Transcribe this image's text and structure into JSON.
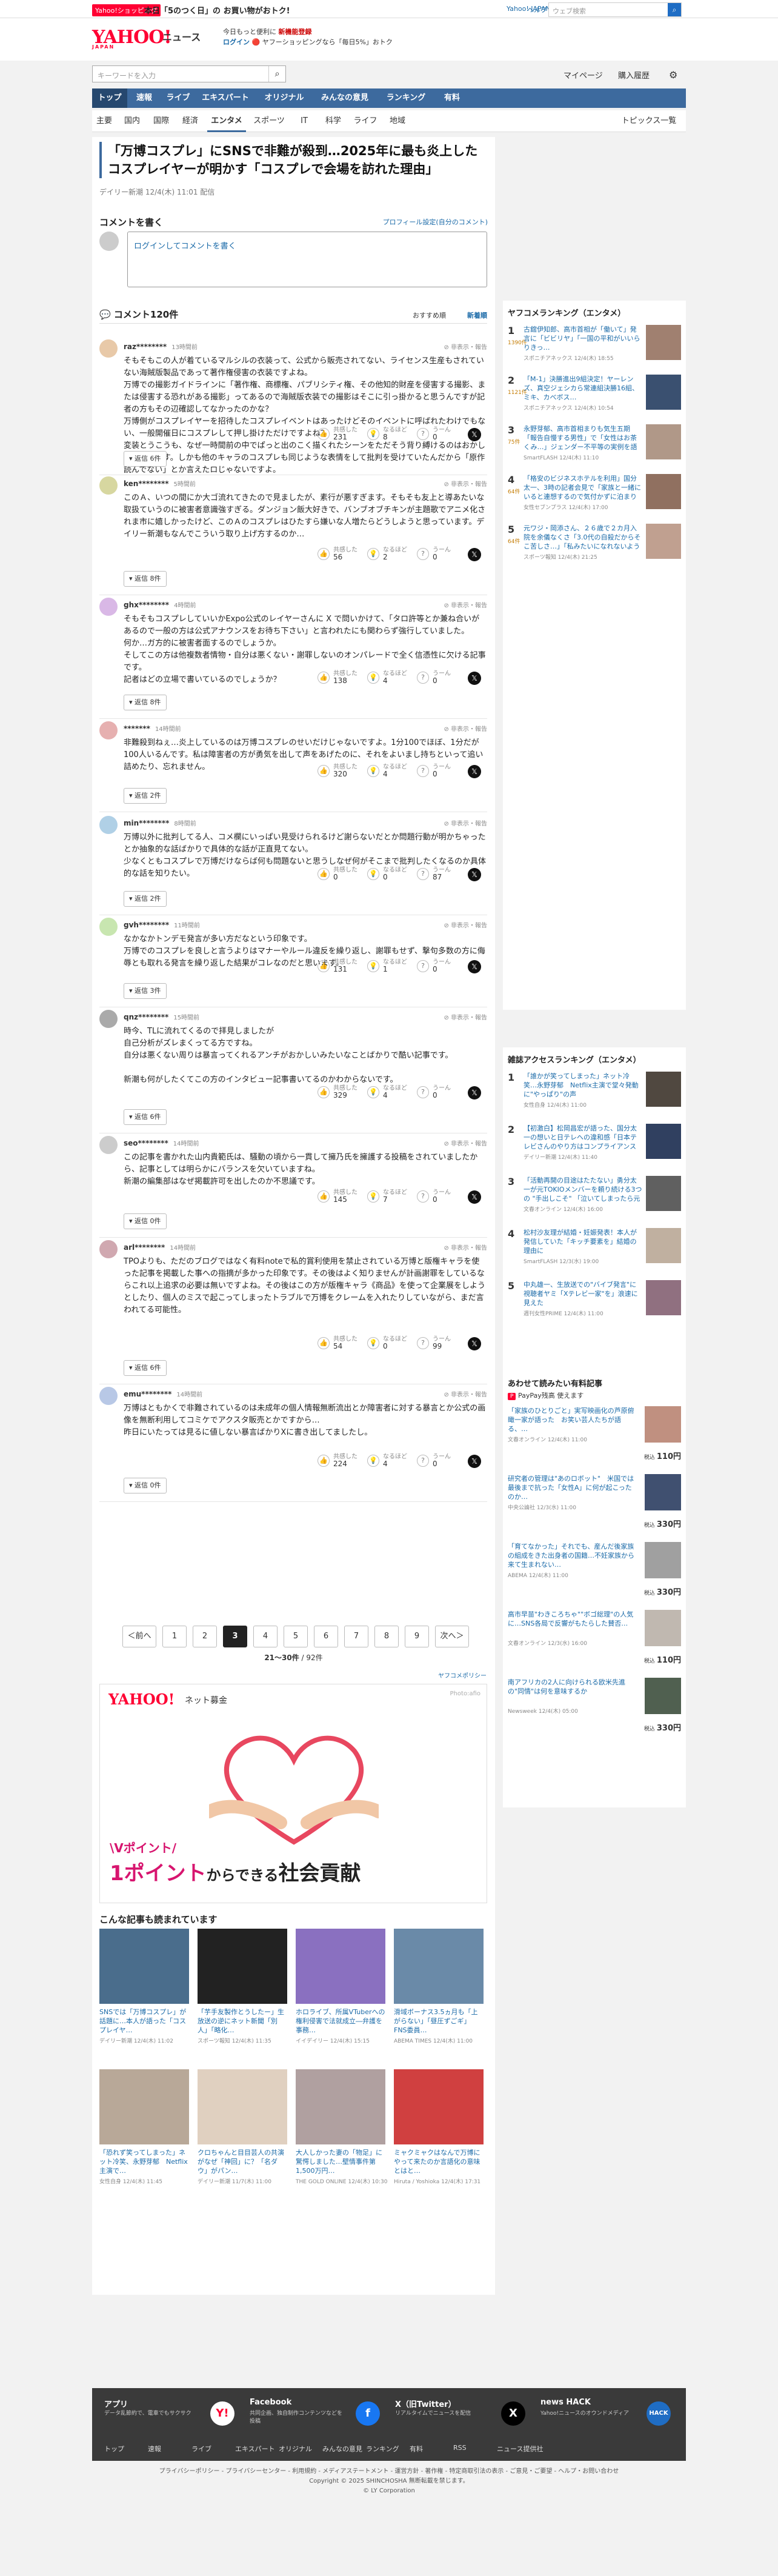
{
  "promo": {
    "tag": "Yahoo!ショッピング",
    "text": "本日「5のつく日」の お買い物がおトク!"
  },
  "header": {
    "logo": "YAHOO!",
    "logo_sub": "JAPAN",
    "service": "ニュース",
    "line1": "今日もっと便利に",
    "line1b": "新機能登録",
    "line2": "ログイン",
    "line2b": "ヤフーショッピングなら「毎日5%」おトク",
    "links": [
      "Yahoo! JAPAN",
      "ヘルプ"
    ],
    "search_ph": "ウェブ検索",
    "search_btn": "検索",
    "kw_ph": "キーワードを入力",
    "util": [
      "マイページ",
      "購入履歴"
    ]
  },
  "nav": {
    "items": [
      "トップ",
      "速報",
      "ライブ",
      "エキスパート",
      "オリジナル",
      "みんなの意見",
      "ランキング",
      "有料"
    ],
    "active": 0
  },
  "subnav": {
    "items": [
      "主要",
      "国内",
      "国際",
      "経済",
      "エンタメ",
      "スポーツ",
      "IT",
      "科学",
      "ライフ",
      "地域"
    ],
    "active": 4,
    "topics": "トピックス一覧"
  },
  "article": {
    "title": "「万博コスプレ」にSNSで非難が殺到…2025年に最も炎上したコスプレイヤーが明かす「コスプレで会場を訪れた理由」",
    "meta": "デイリー新潮 12/4(木) 11:01 配信"
  },
  "comment_form": {
    "heading": "コメントを書く",
    "profile_link": "プロフィール設定(自分のコメント)",
    "placeholder": "ログインしてコメントを書く"
  },
  "comments_header": {
    "title": "コメント120件",
    "sort1": "おすすめ順",
    "sort2": "新着順"
  },
  "labels": {
    "agree": "共感した",
    "think": "なるほど",
    "hmm": "うーん",
    "report": "非表示・報告",
    "reply": "返信"
  },
  "comments": [
    {
      "user": "raz********",
      "time": "13時間前",
      "body": "そもそもこの人が着ているマルシルの衣装って、公式から販売されてない、ライセンス生産もされていない海賊版製品であって著作権侵害の衣装ですよね。\n万博での撮影ガイドラインに「著作権、商標権、パブリシティ権、その他知的財産を侵害する撮影、または侵害する恐れがある撮影」ってあるので海賊版衣装での撮影はそこに引っ掛かると思うんですが記者の方もその辺確認してなかったのかな？\n万博側がコスプレイヤーを招待したコスプレイベントはあったけどそのイベントに呼ばれたわけでもない、一般開催日にコスプレして押し掛けただけですよね？\n変装とうこうも、なぜ一時間前の中でぱっと出のこく描くれたシーンをただそう背り縛けるのはおかしいと思います。しかも他のキャラのコスプレも同じような表情をして批判を受けていたんだから「原作読んでない」とか言えたロじゃないですよ。",
      "agree": "231",
      "think": "8",
      "hmm": "0",
      "replies": "返信 6件"
    },
    {
      "user": "ken********",
      "time": "5時間前",
      "body": "このＡ、いつの間にか大ゴ流れてきたので見ましたが、素行が悪すぎます。そもそも友上と導あたいな取扱ていうのに被害者意識強すぎる。ダンジョン飯大好きで、バンブオブチキンが主題歌でアニメ化されま市に嬉しかったけど、このＡのコスプレはひたすら嫌いな人増たらどうしようと思っています。デイリー新潮もなんでこういう取り上げ方するのか…",
      "agree": "56",
      "think": "2",
      "hmm": "0",
      "replies": "返信 8件"
    },
    {
      "user": "ghx********",
      "time": "4時間前",
      "body": "そもそもコスプレしていいかExpo公式のレイヤーさんに X で問いかけて、「タロ許等とか兼ね合いがあるので一般の方は公式アナウンスをお待ち下さい」と言われたにも関わらず強行していました。\n何か…ガ方的に被害者面するのでしょうか。\nそしてこの方は他複数者情物・自分は悪くない・謝罪しないのオンパレードで全く信憑性に欠ける記事です。\n記者はどの立場で書いているのでしょうか？",
      "agree": "138",
      "think": "4",
      "hmm": "0",
      "replies": "返信 8件"
    },
    {
      "user": "*******",
      "time": "14時間前",
      "body": "非難殺到ねぇ…炎上しているのは万博コスプレのせいだけじゃないですよ。1分100でほぼ、1分だが100人いるんです。私は障害者の方が勇気を出して声をあげたのに、それをよいまし持ちといって追い詰めたり、忘れません。",
      "agree": "320",
      "think": "4",
      "hmm": "0",
      "replies": "返信 2件"
    },
    {
      "user": "min********",
      "time": "8時間前",
      "body": "万博以外に批判してる人、コメ欄にいっぱい見受けられるけど謝らないだとか問題行動が明かちゃったとか抽象的な話ばかりで具体的な話が正直見てない。\n少なくともコスプレで万博だけならば何も問題ないと思うしなぜ何がそこまで批判したくなるのか具体的な話を知りたい。",
      "agree": "0",
      "think": "0",
      "hmm": "87",
      "replies": "返信 2件"
    },
    {
      "user": "gvh********",
      "time": "11時間前",
      "body": "なかなかトンデモ発言が多い方だなという印象です。\n万博でのコスプレを良しと言うよりはマナーやルール違反を繰り返し、謝罪もせず、撃句多数の方に侮辱とも取れる発言を繰り返した結果がコレなのだと思います。",
      "agree": "131",
      "think": "1",
      "hmm": "0",
      "replies": "返信 3件"
    },
    {
      "user": "qnz********",
      "time": "15時間前",
      "body": "時今、TLに流れてくるので拝見しましたが\n自己分析がズレまくってる方ですね。\n自分は悪くない周りは暴言ってくれるアンチがおかしいみたいなことばかりで酷い記事です。\n\n新潮も何がしたくてこの方のインタビュー記事書いてるのかわからないです。",
      "agree": "329",
      "think": "4",
      "hmm": "0",
      "replies": "返信 6件"
    },
    {
      "user": "seo********",
      "time": "14時間前",
      "body": "この記事を書かれた山内貴範氏は、騒動の頃から一貫して擁乃氏を擁護する投稿をされていましたから、記事としては明らかにバランスを欠いていますね。\n新潮の編集部はなぜ掲載許可を出したのか不思議です。",
      "agree": "145",
      "think": "7",
      "hmm": "0",
      "replies": "返信 0件"
    },
    {
      "user": "arl********",
      "time": "14時間前",
      "body": "TPOよりも、ただのブログではなく有料noteで私的賞利使用を禁止されている万博と版権キャラを使った記事を掲載した事への指摘が多かった印象です。その後はよく知りませんが計画謝罪をしているならこれ以上追求の必要は無いですよね。その後はこの方が版権キャラ《商品》を使って企業展をしようとしたり、個人のミスで起こってしまったトラブルで万博をクレームを入れたりしていながら、まだ言われてる可能性。",
      "agree": "54",
      "think": "0",
      "hmm": "99",
      "replies": "返信 6件"
    },
    {
      "user": "emu********",
      "time": "14時間前",
      "body": "万博はともかくで非難されているのは未成年の個人情報無断流出とか障害者に対する暴言とか公式の画像を無断利用してコミケでアクスタ販売とかですから…\n昨日にいたっては見るに値しない暴言ばかりXに書き出してましたし。",
      "agree": "224",
      "think": "4",
      "hmm": "0",
      "replies": "返信 0件"
    }
  ],
  "pagination": {
    "prev": "＜前へ",
    "next": "次へ＞",
    "pages": [
      "1",
      "2",
      "3",
      "4",
      "5",
      "6",
      "7",
      "8",
      "9"
    ],
    "current": "3",
    "info_range": "21〜30件",
    "info_total": "/ 92件",
    "policy": "ヤフコメポリシー"
  },
  "ad": {
    "logo": "YAHOO!",
    "service": "ネット募金",
    "credit": "Photo:afio",
    "vpoint": "\\Vポイント/",
    "line_a": "1ポイント",
    "line_b": "からできる",
    "line_c": "社会貢献"
  },
  "related": {
    "heading": "こんな記事も読まれています",
    "items": [
      {
        "title": "SNSでは「万博コスプレ」が話題に…本人が語った「コスプレイヤ…",
        "src": "デイリー新潮",
        "date": "12/4(木) 11:02"
      },
      {
        "title": "「芋手友製作とうしたー」生放送の逆にネット新聞「別人」「略化…",
        "src": "スポーツ報知",
        "date": "12/4(木) 11:35"
      },
      {
        "title": "ホロライブ、所属VTuberへの権利侵害で法就成立―弁護を事務…",
        "src": "イイデイリー",
        "date": "12/4(木) 15:15"
      },
      {
        "title": "滑域ボーナス3.5ヵ月も「上がらない」「昼圧ずごギ」FNS委員…",
        "src": "ABEMA TIMES",
        "date": "12/4(木) 11:00"
      },
      {
        "title": "「恐れず笑ってしまった」ネット冷笑、永野芽郁　Netflix主演で…",
        "src": "女性自身",
        "date": "12/4(木) 11:45"
      },
      {
        "title": "クロちゃんと目目芸人の共演がなぜ「神回」に？「名ダウ」がパン…",
        "src": "デイリー新潮",
        "date": "11/7(木) 11:00"
      },
      {
        "title": "大人しかった妻の「物足」に驚愕しました…壁情事件第1,500万円…",
        "src": "THE GOLD ONLINE",
        "date": "12/4(木) 10:30"
      },
      {
        "title": "ミャクミャクはなんで万博にやって来たのか言語化の意味とはと…",
        "src": "Hiruta / Yoshioka",
        "date": "12/4(木) 17:31"
      }
    ]
  },
  "side_ranking": {
    "heading": "ヤフコメランキング（エンタメ）",
    "items": [
      {
        "no": "1",
        "cnt": "1390件",
        "title": "古舘伊知郎、高市首相が「働いて」発言に「ビビリヤ」「一国の平和がいいらりきっ…",
        "src": "スポニチアネックス",
        "date": "12/4(木) 18:55"
      },
      {
        "no": "2",
        "cnt": "1121件",
        "title": "「M-1」決勝進出9組決定！ヤーレンズ、真空ジェシカら常連組決勝16組、ミキ、カべボス…",
        "src": "スポニチアネックス",
        "date": "12/4(木) 10:54"
      },
      {
        "no": "3",
        "cnt": "75件",
        "title": "永野芽郁、高市首相まりも気生五期「報告自慢する男性」で「女性はお茶くみ…」ジェンダー不平等の実例を語る",
        "src": "SmartFLASH",
        "date": "12/4(木) 11:10"
      },
      {
        "no": "4",
        "cnt": "64件",
        "title": "「格安のビジネスホテルを利用」国分太一、3時の記者会見で「家族と一緒にいると連想するので気付かずに泊まりました」",
        "src": "女性セブンプラス",
        "date": "12/4(木) 17:00"
      },
      {
        "no": "5",
        "cnt": "64件",
        "title": "元ワジ・岡添さん、２６歳で２カ月入院を余儀なくさ「3.0代の自殺だからそこ苦しさ…」「私みたいになれないように」",
        "src": "スポーツ報知",
        "date": "12/4(木) 21:25"
      }
    ]
  },
  "side_access": {
    "heading": "雑誌アクセスランキング（エンタメ）",
    "items": [
      {
        "no": "1",
        "title": "「誰かが笑ってしまった」ネット冷笑…永野芽郁　Netflix主演で堂々発動に\"やっぱり\"の声",
        "src": "女性自身",
        "date": "12/4(木) 11:00"
      },
      {
        "no": "2",
        "title": "【初激白】松岡昌宏が語った、国分太一の想いと日テレへの違和感「日本テレビさんのやり方はコンプライアンス違反ではないのか」",
        "src": "デイリー新潮",
        "date": "12/4(木) 11:40"
      },
      {
        "no": "3",
        "title": "「活動再開の目途はたたない」勇分太一が元TOKIOメンバーを頼り続ける3つ の \"手出しこそ\" 「泣いてしまったら元の…」",
        "src": "文春オンライン",
        "date": "12/4(木) 16:00"
      },
      {
        "no": "4",
        "title": "松村沙友理が結婚・妊娠発表！本人が発信していた「キッチ要素を」結婚の理由に",
        "src": "SmartFLASH",
        "date": "12/3(水) 19:00"
      },
      {
        "no": "5",
        "title": "中丸雄一、生放送での\"バイブ発言\"に視聴者ヤミ「Xテレビ一家\"を」浪速に見えた",
        "src": "週刊女性PRIME",
        "date": "12/4(木) 11:00"
      }
    ]
  },
  "side_paid": {
    "heading": "あわせて読みたい有料記事",
    "badge": "PayPay残高 使えます",
    "price_label": "税込",
    "items": [
      {
        "title": "「家族のひとりごと」実写映画化の芦原俯瞰一家が語った　お笑い芸人たちが語る、…",
        "src": "文春オンライン",
        "date": "12/4(木) 11:00",
        "price": "110円"
      },
      {
        "title": "研究者の管理は\"あのロボット\"　米国では最後まで抗った「女性A」に何が起こったのか…",
        "src": "中央公論社",
        "date": "12/3(水) 11:00",
        "price": "330円"
      },
      {
        "title": "「育てなかった」それでも、産んだ後家族の組成をきた出身者の国籍…不妊家族から来て生まれない…",
        "src": "ABEMA",
        "date": "12/4(木) 11:00",
        "price": "330円"
      },
      {
        "title": "高市早苗\"わきころちゃ\"\"ボゴ総理\"の人気に…SNS各局で反響がもたらした賛否…",
        "src": "文春オンライン",
        "date": "12/3(水) 16:00",
        "price": "110円"
      },
      {
        "title": "南アフリカの2人に向けられる欧米先進の\"同情\"は何を意味するか",
        "src": "Newsweek",
        "date": "12/4(木) 05:00",
        "price": "330円"
      }
    ]
  },
  "footer": {
    "cols": [
      {
        "h": "アプリ",
        "d": "データ乱節約で、電車でもサクサク",
        "ic": "Y!"
      },
      {
        "h": "Facebook",
        "d": "共同企画、独自制作コンテンツなどを投稿",
        "ic": "f"
      },
      {
        "h": "X（旧Twitter）",
        "d": "リアルタイムでニュースを配信",
        "ic": "X"
      },
      {
        "h": "news HACK",
        "d": "Yahoo!ニュースのオウンドメディア",
        "ic": "HACK"
      }
    ],
    "nav": [
      "トップ",
      "速報",
      "ライブ",
      "エキスパート",
      "オリジナル",
      "みんなの意見",
      "ランキング",
      "有料",
      "RSS",
      "ニュース提供社"
    ],
    "legal": "プライバシーポリシー - プライバシーセンター - 利用規約 - メディアステートメント - 運営方針 - 著作権 - 特定商取引法の表示 - ご意見・ご要望 - ヘルプ・お問い合わせ",
    "copyright": "Copyright © 2025 SHINCHOSHA 無断転載を禁じます。",
    "corp": "© LY Corporation"
  }
}
